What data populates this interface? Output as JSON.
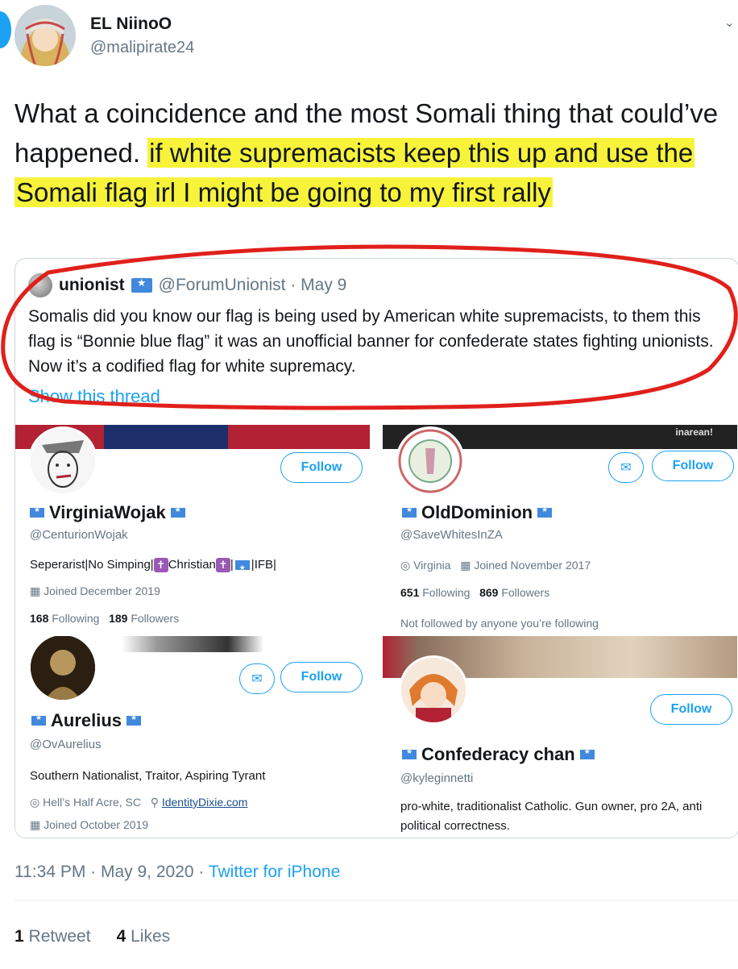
{
  "author": {
    "name": "EL NiinoO",
    "handle": "@malipirate24"
  },
  "tweet": {
    "text_plain": "What a coincidence and the most Somali thing that could’ve happened. ",
    "text_highlighted": "if white supremacists keep this up and use the Somali flag irl I might be going to my first rally"
  },
  "quote": {
    "name": "unionist",
    "meta": "@ForumUnionist · May 9",
    "body": "Somalis did you know our flag is being used by American white supremacists, to them this flag is “Bonnie blue flag” it was an unofficial banner for confederate states fighting unionists. Now it’s a codified flag for white supremacy.",
    "thread_link": "Show this thread"
  },
  "profiles": [
    {
      "name": "VirginiaWojak",
      "handle": "@CenturionWojak",
      "bio_parts": [
        "Seperarist|No Simping|",
        "Christian",
        "|",
        "|IFB|"
      ],
      "joined": "Joined December 2019",
      "following_count": "168",
      "following_label": "Following",
      "followers_count": "189",
      "followers_label": "Followers",
      "follow_label": "Follow"
    },
    {
      "name": "OldDominion",
      "handle": "@SaveWhitesInZA",
      "location": "Virginia",
      "joined": "Joined November 2017",
      "following_count": "651",
      "following_label": "Following",
      "followers_count": "869",
      "followers_label": "Followers",
      "note": "Not followed by anyone you’re following",
      "follow_label": "Follow",
      "banner_text": "inarean!"
    },
    {
      "name": "Aurelius",
      "handle": "@OvAurelius",
      "bio": "Southern Nationalist, Traitor, Aspiring Tyrant",
      "location": "Hell’s Half Acre, SC",
      "website": "IdentityDixie.com",
      "joined": "Joined October 2019",
      "follow_label": "Follow"
    },
    {
      "name": "Confederacy chan",
      "handle": "@kyleginnetti",
      "bio": "pro-white, traditionalist Catholic. Gun owner, pro 2A, anti political correctness.",
      "follow_label": "Follow"
    }
  ],
  "footer": {
    "time": "11:34 PM · May 9, 2020 · ",
    "source": "Twitter for iPhone",
    "retweet_count": "1",
    "retweet_label": "Retweet",
    "like_count": "4",
    "like_label": "Likes"
  },
  "colors": {
    "highlight": "#f7f33b",
    "circle": "#e0201b",
    "link": "#1da1f2",
    "somali_flag": "#4189dd"
  },
  "icons": [
    "flag-badge-icon",
    "calendar-icon",
    "location-icon",
    "link-icon",
    "message-icon",
    "cross-icon"
  ]
}
